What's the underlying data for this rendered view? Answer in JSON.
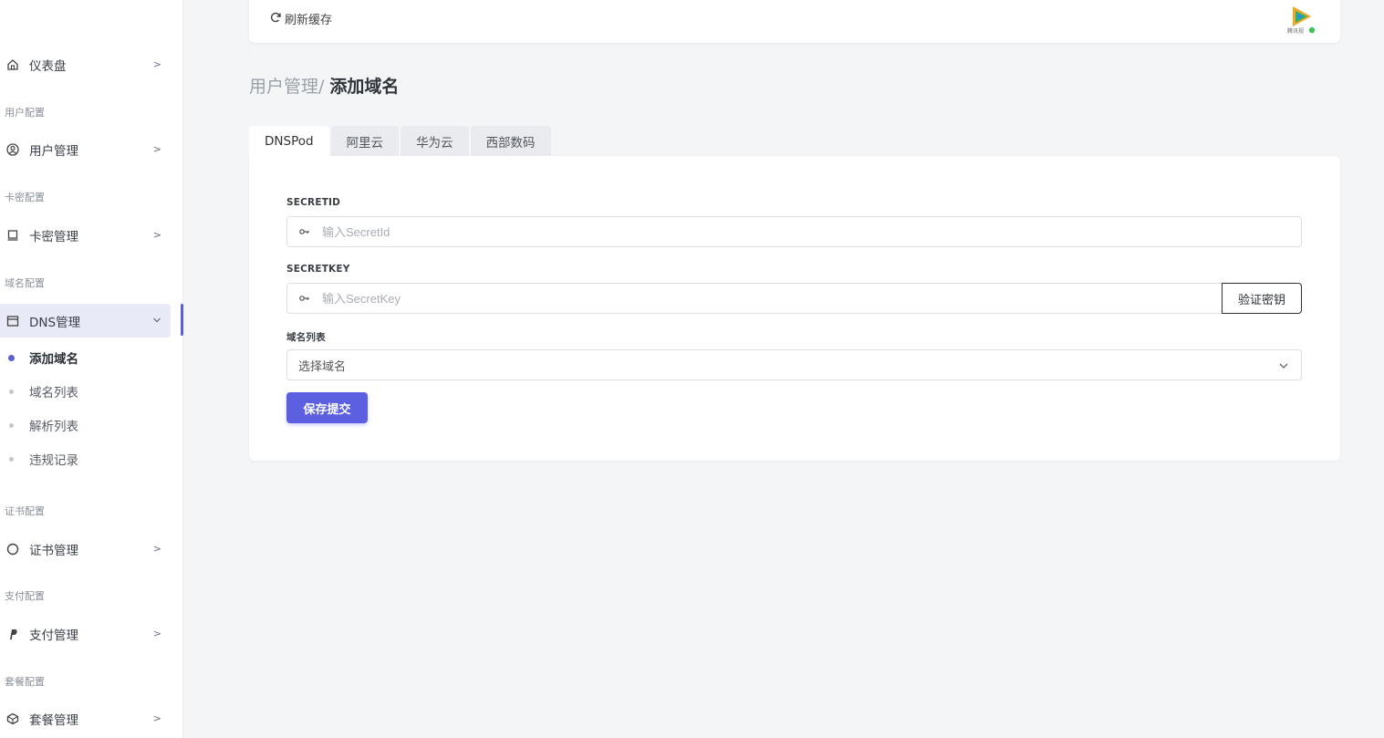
{
  "sidebar": {
    "items": [
      {
        "label": "仪表盘",
        "icon": "home-icon"
      },
      {
        "group": "用户配置",
        "label": "用户管理",
        "icon": "user-circle-icon"
      },
      {
        "group": "卡密配置",
        "label": "卡密管理",
        "icon": "card-icon"
      },
      {
        "group": "域名配置",
        "label": "DNS管理",
        "icon": "window-icon",
        "expanded": true
      },
      {
        "group": "证书配置",
        "label": "证书管理",
        "icon": "circle-icon"
      },
      {
        "group": "支付配置",
        "label": "支付管理",
        "icon": "paypal-icon"
      },
      {
        "group": "套餐配置",
        "label": "套餐管理",
        "icon": "box-icon"
      }
    ],
    "dns_sub": [
      {
        "label": "添加域名",
        "active": true
      },
      {
        "label": "域名列表"
      },
      {
        "label": "解析列表"
      },
      {
        "label": "违规记录"
      }
    ],
    "accent": "#5a5fd1"
  },
  "topbar": {
    "refresh_label": "刷新缓存",
    "avatar_caption": "腾讯视"
  },
  "breadcrumb": {
    "parent": "用户管理",
    "sep": "/",
    "current": "添加域名"
  },
  "tabs": [
    "DNSPod",
    "阿里云",
    "华为云",
    "西部数码"
  ],
  "form": {
    "secretid_label": "SECRETID",
    "secretid_placeholder": "输入SecretId",
    "secretkey_label": "SECRETKEY",
    "secretkey_placeholder": "输入SecretKey",
    "verify_label": "验证密钥",
    "domain_label": "域名列表",
    "domain_value": "选择域名",
    "submit_label": "保存提交"
  },
  "colors": {
    "primary": "#5b5fe0",
    "background": "#f4f5f7"
  }
}
